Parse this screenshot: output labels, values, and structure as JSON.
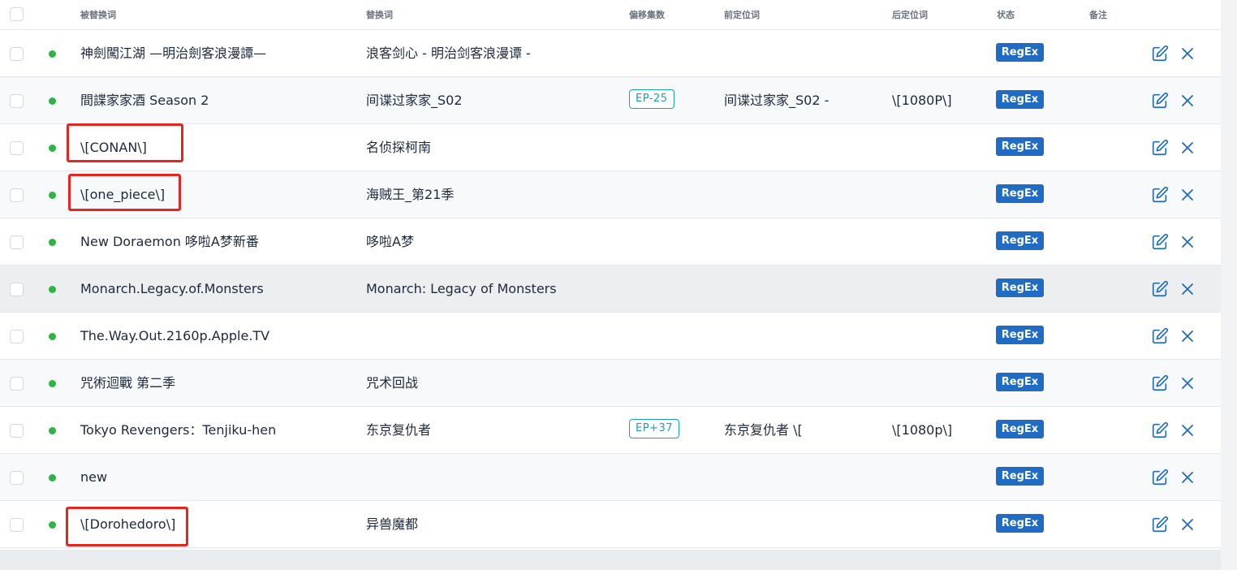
{
  "table": {
    "headers": {
      "source": "被替换词",
      "replacement": "替换词",
      "offset": "偏移集数",
      "prefix": "前定位词",
      "suffix": "后定位词",
      "status": "状态",
      "note": "备注"
    },
    "rows": [
      {
        "source": "神劍闖江湖 —明治劍客浪漫譚—",
        "replacement": "浪客剑心 - 明治剑客浪漫谭 -",
        "offset": "",
        "prefix": "",
        "suffix": "",
        "status": "RegEx"
      },
      {
        "source": "間諜家家酒 Season 2",
        "replacement": "间谍过家家_S02",
        "offset": "EP-25",
        "prefix": "间谍过家家_S02 -",
        "suffix": "\\[1080P\\]",
        "status": "RegEx"
      },
      {
        "source": "\\[CONAN\\]",
        "replacement": "名侦探柯南",
        "offset": "",
        "prefix": "",
        "suffix": "",
        "status": "RegEx"
      },
      {
        "source": "\\[one_piece\\]",
        "replacement": "海贼王_第21季",
        "offset": "",
        "prefix": "",
        "suffix": "",
        "status": "RegEx"
      },
      {
        "source": "New Doraemon 哆啦A梦新番",
        "replacement": "哆啦A梦",
        "offset": "",
        "prefix": "",
        "suffix": "",
        "status": "RegEx"
      },
      {
        "source": "Monarch.Legacy.of.Monsters",
        "replacement": "Monarch: Legacy of Monsters",
        "offset": "",
        "prefix": "",
        "suffix": "",
        "status": "RegEx"
      },
      {
        "source": "The.Way.Out.2160p.Apple.TV",
        "replacement": "",
        "offset": "",
        "prefix": "",
        "suffix": "",
        "status": "RegEx"
      },
      {
        "source": "咒術迴戰 第二季",
        "replacement": "咒术回战",
        "offset": "",
        "prefix": "",
        "suffix": "",
        "status": "RegEx"
      },
      {
        "source": "Tokyo Revengers：Tenjiku-hen",
        "replacement": "东京复仇者",
        "offset": "EP+37",
        "prefix": "东京复仇者 \\[",
        "suffix": "\\[1080p\\]",
        "status": "RegEx"
      },
      {
        "source": "new",
        "replacement": "",
        "offset": "",
        "prefix": "",
        "suffix": "",
        "status": "RegEx"
      },
      {
        "source": "\\[Dorohedoro\\]",
        "replacement": "异兽魔都",
        "offset": "",
        "prefix": "",
        "suffix": "",
        "status": "RegEx"
      }
    ]
  },
  "icons": {
    "status_dot": "status-dot-icon",
    "edit": "edit-icon",
    "delete": "close-icon"
  },
  "colors": {
    "status_active": "#2fb344",
    "badge": "#206bc4",
    "offset_tag": "#17a2b8",
    "action_icon": "#206bc4",
    "highlight_box": "#e8241f"
  }
}
